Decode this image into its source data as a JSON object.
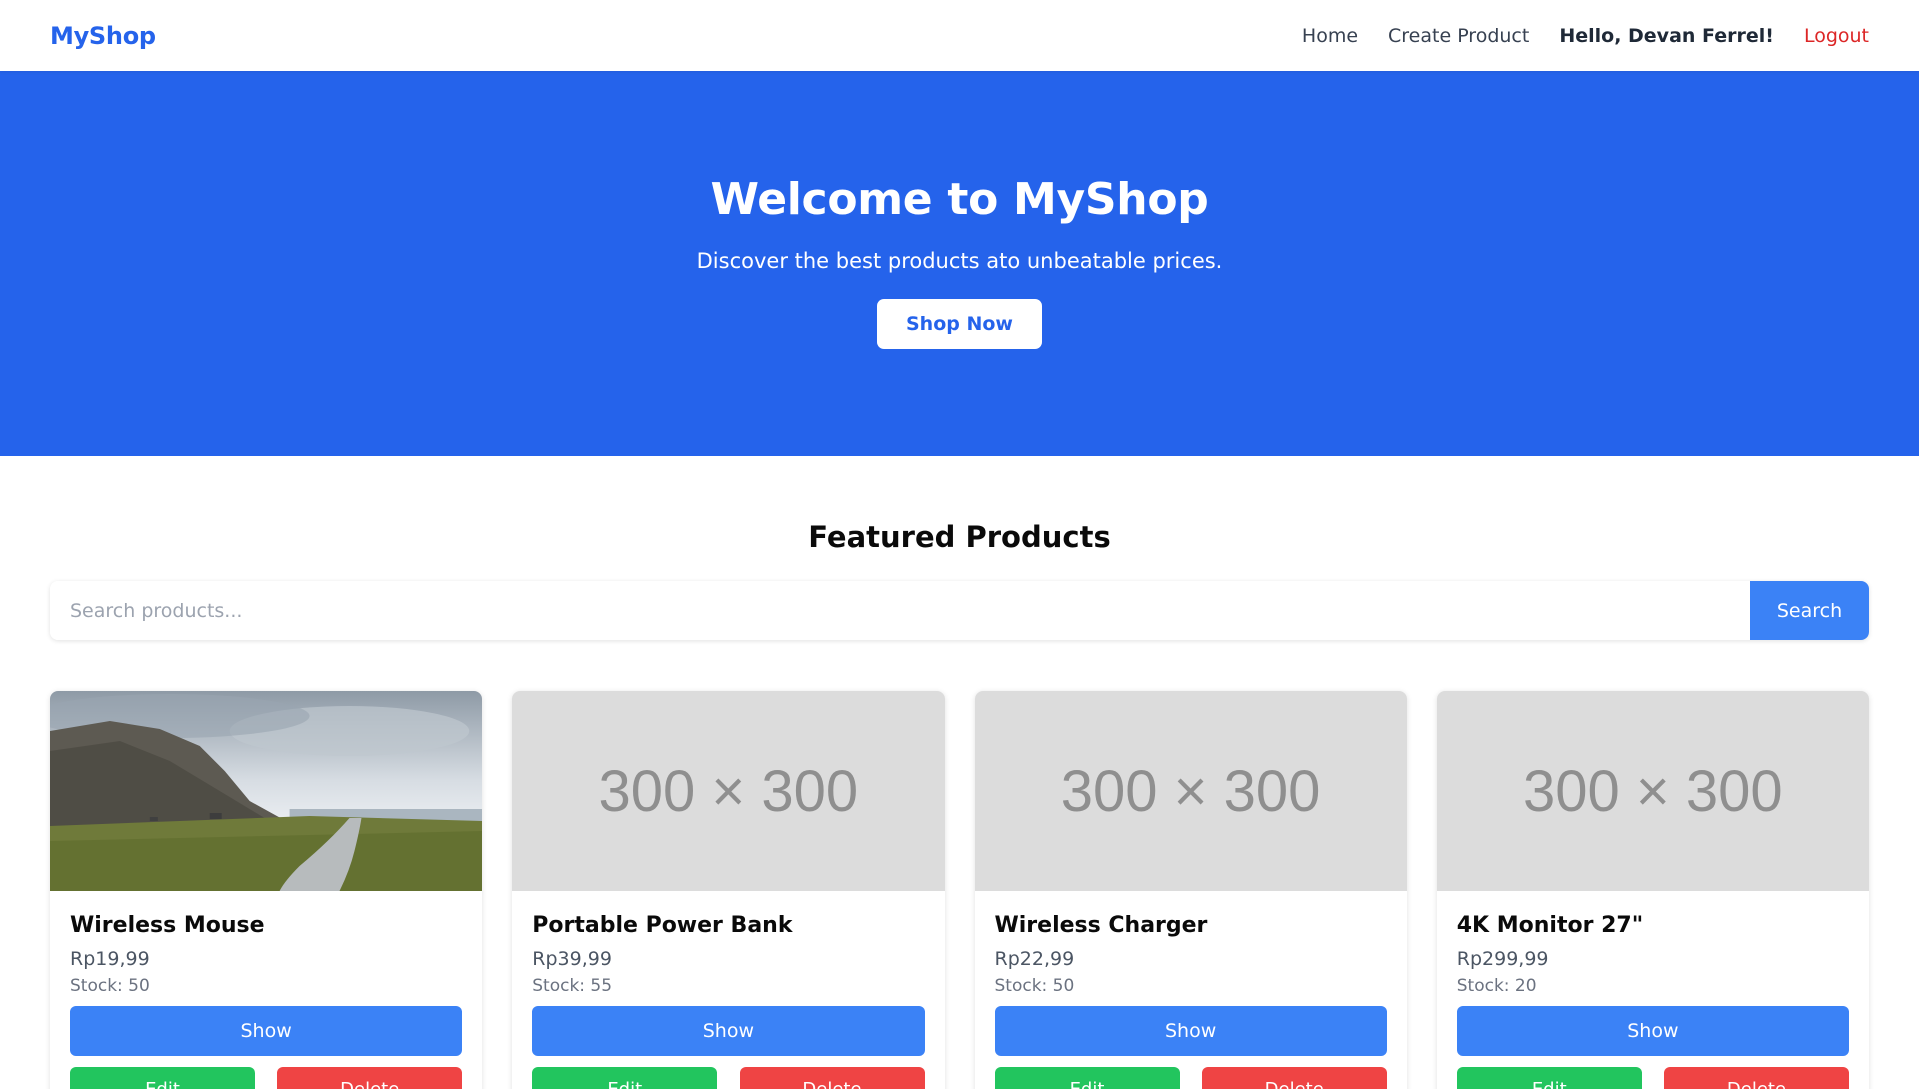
{
  "nav": {
    "brand": "MyShop",
    "links": [
      "Home",
      "Create Product"
    ],
    "greeting": "Hello, Devan Ferrel!",
    "logout": "Logout"
  },
  "hero": {
    "title": "Welcome to MyShop",
    "subtitle": "Discover the best products ato unbeatable prices.",
    "button": "Shop Now",
    "background": "#2563eb"
  },
  "featured": {
    "title": "Featured Products",
    "search_placeholder": "Search products...",
    "search_button": "Search"
  },
  "products": [
    {
      "name": "Wireless Mouse",
      "price": "Rp19,99",
      "stock": "Stock: 50",
      "image": "landscape-photo",
      "show": "Show",
      "edit": "Edit",
      "delete": "Delete"
    },
    {
      "name": "Portable Power Bank",
      "price": "Rp39,99",
      "stock": "Stock: 55",
      "image": "300 × 300",
      "show": "Show",
      "edit": "Edit",
      "delete": "Delete"
    },
    {
      "name": "Wireless Charger",
      "price": "Rp22,99",
      "stock": "Stock: 50",
      "image": "300 × 300",
      "show": "Show",
      "edit": "Edit",
      "delete": "Delete"
    },
    {
      "name": "4K Monitor 27\"",
      "price": "Rp299,99",
      "stock": "Stock: 20",
      "image": "300 × 300",
      "show": "Show",
      "edit": "Edit",
      "delete": "Delete"
    }
  ]
}
